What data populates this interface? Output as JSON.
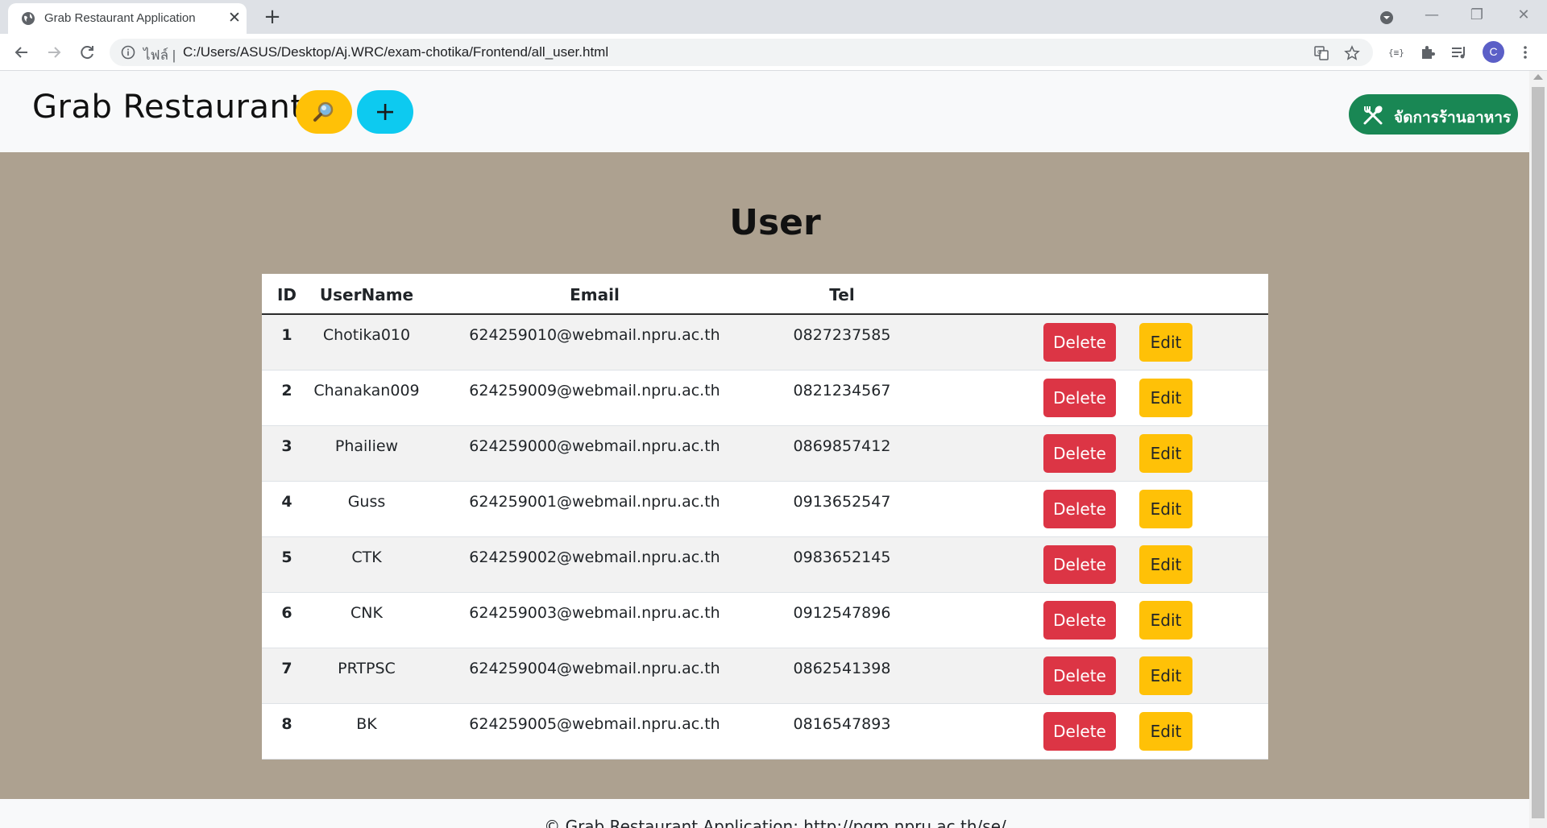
{
  "browser": {
    "tab_title": "Grab Restaurant Application",
    "url_prefix": "ไฟล์ |",
    "url": "C:/Users/ASUS/Desktop/Aj.WRC/exam-chotika/Frontend/all_user.html",
    "profile_initial": "C"
  },
  "navbar": {
    "brand": "Grab Restaurant",
    "manage_label": "จัดการร้านอาหาร"
  },
  "page": {
    "title": "User"
  },
  "table": {
    "headers": [
      "ID",
      "UserName",
      "Email",
      "Tel"
    ],
    "delete_label": "Delete",
    "edit_label": "Edit",
    "rows": [
      {
        "id": "1",
        "username": "Chotika010",
        "email": "624259010@webmail.npru.ac.th",
        "tel": "0827237585"
      },
      {
        "id": "2",
        "username": "Chanakan009",
        "email": "624259009@webmail.npru.ac.th",
        "tel": "0821234567"
      },
      {
        "id": "3",
        "username": "Phailiew",
        "email": "624259000@webmail.npru.ac.th",
        "tel": "0869857412"
      },
      {
        "id": "4",
        "username": "Guss",
        "email": "624259001@webmail.npru.ac.th",
        "tel": "0913652547"
      },
      {
        "id": "5",
        "username": "CTK",
        "email": "624259002@webmail.npru.ac.th",
        "tel": "0983652145"
      },
      {
        "id": "6",
        "username": "CNK",
        "email": "624259003@webmail.npru.ac.th",
        "tel": "0912547896"
      },
      {
        "id": "7",
        "username": "PRTPSC",
        "email": "624259004@webmail.npru.ac.th",
        "tel": "0862541398"
      },
      {
        "id": "8",
        "username": "BK",
        "email": "624259005@webmail.npru.ac.th",
        "tel": "0816547893"
      }
    ]
  },
  "footer": {
    "text": "© Grab Restaurant Application: http://pgm.npru.ac.th/se/"
  },
  "icons": {
    "favicon": "globe-icon",
    "search_button": "magnifier-icon",
    "add_button": "plus-icon",
    "manage_button": "fork-spoon-icon"
  },
  "colors": {
    "main_bg": "#ada190",
    "delete": "#dc3545",
    "edit": "#ffc107",
    "add": "#0dcaf0",
    "manage": "#198754"
  }
}
